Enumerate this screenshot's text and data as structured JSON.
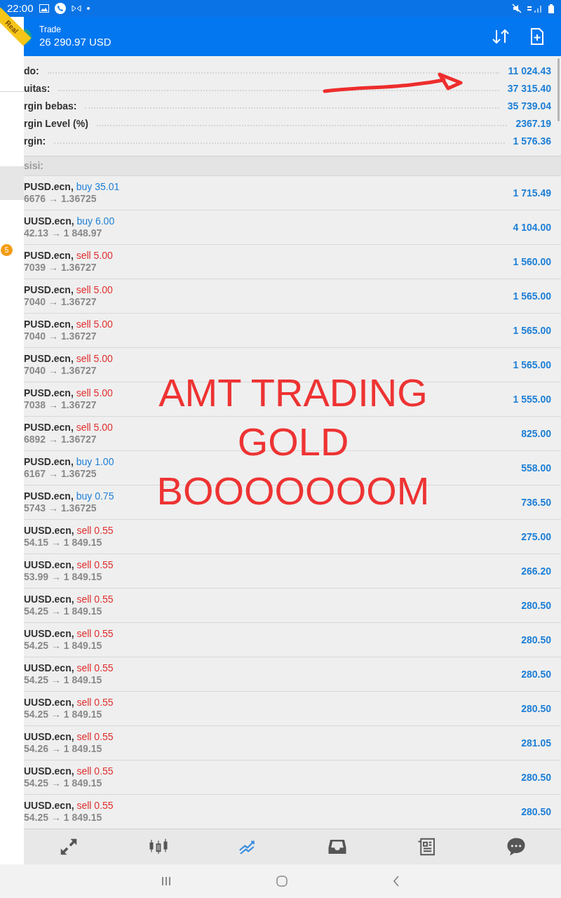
{
  "status_bar": {
    "time": "22:00"
  },
  "drawer": {
    "ribbon": "Real",
    "badge": "5"
  },
  "header": {
    "title": "Trade",
    "balance": "26 290.97 USD"
  },
  "summary": [
    {
      "label": "do:",
      "value": "11 024.43"
    },
    {
      "label": "uitas:",
      "value": "37 315.40"
    },
    {
      "label": "rgin bebas:",
      "value": "35 739.04"
    },
    {
      "label": "rgin Level (%)",
      "value": "2367.19"
    },
    {
      "label": "rgin:",
      "value": "1 576.36"
    }
  ],
  "positions_title": "sisi:",
  "positions": [
    {
      "symbol": "PUSD.ecn,",
      "kind": "buy",
      "order": "buy 35.01",
      "prices": "6676 → 1.36725",
      "profit": "1 715.49"
    },
    {
      "symbol": "UUSD.ecn,",
      "kind": "buy",
      "order": "buy 6.00",
      "prices": "42.13 → 1 848.97",
      "profit": "4 104.00"
    },
    {
      "symbol": "PUSD.ecn,",
      "kind": "sell",
      "order": "sell 5.00",
      "prices": "7039 → 1.36727",
      "profit": "1 560.00"
    },
    {
      "symbol": "PUSD.ecn,",
      "kind": "sell",
      "order": "sell 5.00",
      "prices": "7040 → 1.36727",
      "profit": "1 565.00"
    },
    {
      "symbol": "PUSD.ecn,",
      "kind": "sell",
      "order": "sell 5.00",
      "prices": "7040 → 1.36727",
      "profit": "1 565.00"
    },
    {
      "symbol": "PUSD.ecn,",
      "kind": "sell",
      "order": "sell 5.00",
      "prices": "7040 → 1.36727",
      "profit": "1 565.00"
    },
    {
      "symbol": "PUSD.ecn,",
      "kind": "sell",
      "order": "sell 5.00",
      "prices": "7038 → 1.36727",
      "profit": "1 555.00"
    },
    {
      "symbol": "PUSD.ecn,",
      "kind": "sell",
      "order": "sell 5.00",
      "prices": "6892 → 1.36727",
      "profit": "825.00"
    },
    {
      "symbol": "PUSD.ecn,",
      "kind": "buy",
      "order": "buy 1.00",
      "prices": "6167 → 1.36725",
      "profit": "558.00"
    },
    {
      "symbol": "PUSD.ecn,",
      "kind": "buy",
      "order": "buy 0.75",
      "prices": "5743 → 1.36725",
      "profit": "736.50"
    },
    {
      "symbol": "UUSD.ecn,",
      "kind": "sell",
      "order": "sell 0.55",
      "prices": "54.15 → 1 849.15",
      "profit": "275.00"
    },
    {
      "symbol": "UUSD.ecn,",
      "kind": "sell",
      "order": "sell 0.55",
      "prices": "53.99 → 1 849.15",
      "profit": "266.20"
    },
    {
      "symbol": "UUSD.ecn,",
      "kind": "sell",
      "order": "sell 0.55",
      "prices": "54.25 → 1 849.15",
      "profit": "280.50"
    },
    {
      "symbol": "UUSD.ecn,",
      "kind": "sell",
      "order": "sell 0.55",
      "prices": "54.25 → 1 849.15",
      "profit": "280.50"
    },
    {
      "symbol": "UUSD.ecn,",
      "kind": "sell",
      "order": "sell 0.55",
      "prices": "54.25 → 1 849.15",
      "profit": "280.50"
    },
    {
      "symbol": "UUSD.ecn,",
      "kind": "sell",
      "order": "sell 0.55",
      "prices": "54.25 → 1 849.15",
      "profit": "280.50"
    },
    {
      "symbol": "UUSD.ecn,",
      "kind": "sell",
      "order": "sell 0.55",
      "prices": "54.26 → 1 849.15",
      "profit": "281.05"
    },
    {
      "symbol": "UUSD.ecn,",
      "kind": "sell",
      "order": "sell 0.55",
      "prices": "54.25 → 1 849.15",
      "profit": "280.50"
    },
    {
      "symbol": "UUSD.ecn,",
      "kind": "sell",
      "order": "sell 0.55",
      "prices": "54.25 → 1 849.15",
      "profit": "280.50"
    }
  ],
  "nav": [
    {
      "kind": "arrows",
      "selected": false
    },
    {
      "kind": "candles",
      "selected": false
    },
    {
      "kind": "trade",
      "selected": true
    },
    {
      "kind": "inbox",
      "selected": false
    },
    {
      "kind": "news",
      "selected": false
    },
    {
      "kind": "chat",
      "selected": false
    }
  ],
  "annotation": {
    "lines": [
      "AMT TRADING",
      "GOLD",
      "BOOOOOOOM"
    ]
  }
}
